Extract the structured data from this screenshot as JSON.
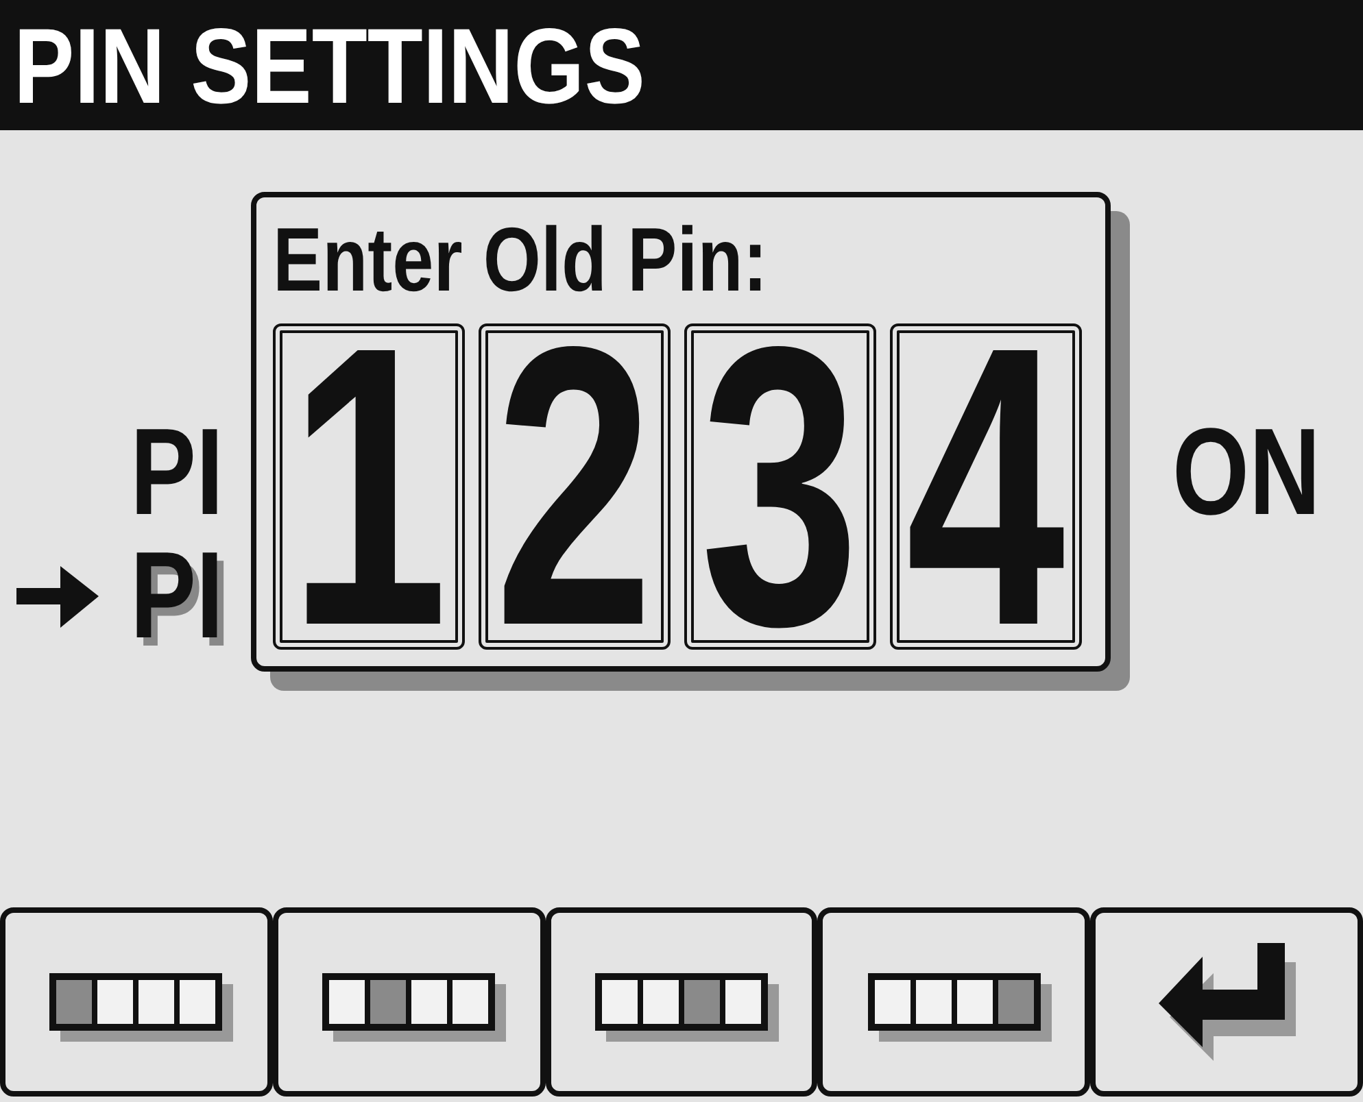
{
  "header": {
    "title": "PIN SETTINGS"
  },
  "menu": [
    {
      "label": "PI",
      "value": "ON",
      "selected": false
    },
    {
      "label": "PI",
      "selected": true
    }
  ],
  "dialog": {
    "title": "Enter Old Pin:",
    "digits": [
      "1",
      "2",
      "3",
      "4"
    ]
  },
  "keys": [
    {
      "kind": "position",
      "cells": [
        {
          "selected": true
        },
        {
          "selected": false
        },
        {
          "selected": false
        },
        {
          "selected": false
        }
      ]
    },
    {
      "kind": "position",
      "cells": [
        {
          "selected": false
        },
        {
          "selected": true
        },
        {
          "selected": false
        },
        {
          "selected": false
        }
      ]
    },
    {
      "kind": "position",
      "cells": [
        {
          "selected": false
        },
        {
          "selected": false
        },
        {
          "selected": true
        },
        {
          "selected": false
        }
      ]
    },
    {
      "kind": "position",
      "cells": [
        {
          "selected": false
        },
        {
          "selected": false
        },
        {
          "selected": false
        },
        {
          "selected": true
        }
      ]
    },
    {
      "kind": "enter"
    }
  ]
}
